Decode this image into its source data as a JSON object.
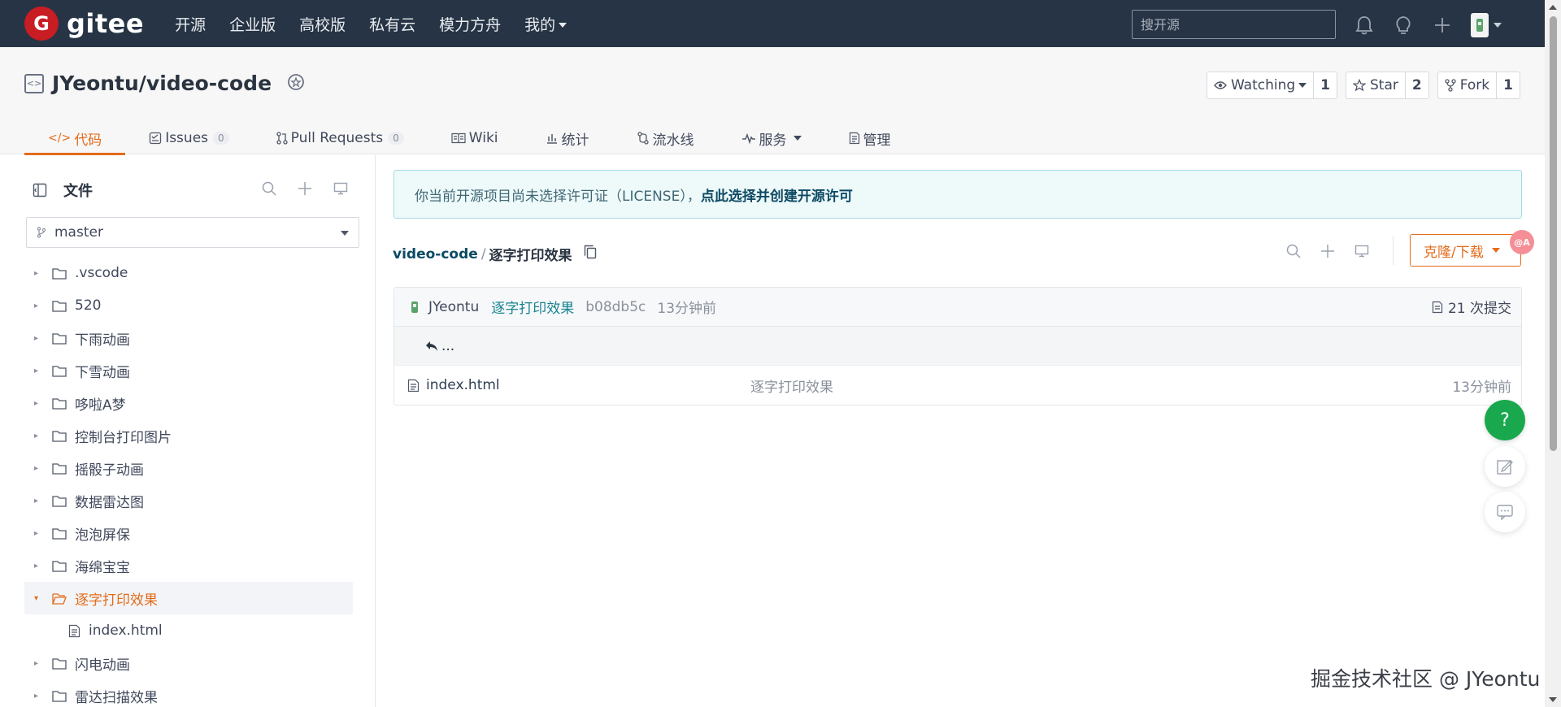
{
  "topbar": {
    "logo_letter": "G",
    "logo_text": "gitee",
    "nav": [
      "开源",
      "企业版",
      "高校版",
      "私有云",
      "模力方舟",
      "我的"
    ],
    "search_placeholder": "搜开源"
  },
  "repo": {
    "full_name": "JYeontu/video-code",
    "watch": {
      "label": "Watching",
      "count": "1"
    },
    "star": {
      "label": "Star",
      "count": "2"
    },
    "fork": {
      "label": "Fork",
      "count": "1"
    },
    "tabs": [
      {
        "label": "代码",
        "active": true
      },
      {
        "label": "Issues",
        "count": "0"
      },
      {
        "label": "Pull Requests",
        "count": "0"
      },
      {
        "label": "Wiki"
      },
      {
        "label": "统计"
      },
      {
        "label": "流水线"
      },
      {
        "label": "服务"
      },
      {
        "label": "管理"
      }
    ]
  },
  "sidebar": {
    "title": "文件",
    "branch": "master",
    "tree": [
      ".vscode",
      "520",
      "下雨动画",
      "下雪动画",
      "哆啦A梦",
      "控制台打印图片",
      "摇骰子动画",
      "数据雷达图",
      "泡泡屏保",
      "海绵宝宝",
      "逐字打印效果",
      "index.html",
      "闪电动画",
      "雷达扫描效果"
    ]
  },
  "main": {
    "notice_text": "你当前开源项目尚未选择许可证（LICENSE），",
    "notice_link": "点此选择并创建开源许可",
    "crumb_root": "video-code",
    "crumb_sep": "/",
    "crumb_current": "逐字打印效果",
    "clone_label": "克隆/下载",
    "commit": {
      "author": "JYeontu",
      "message": "逐字打印效果",
      "sha": "b08db5c",
      "time": "13分钟前",
      "count": "21 次提交"
    },
    "back": "...",
    "files": [
      {
        "name": "index.html",
        "message": "逐字打印效果",
        "time": "13分钟前"
      }
    ]
  },
  "float": {
    "help": "?",
    "mini": "@A"
  },
  "watermark": "掘金技术社区 @ JYeontu",
  "colors": {
    "accent": "#e46b1a",
    "brand": "#c71d23",
    "topbar": "#263445",
    "help": "#1aa84f"
  }
}
